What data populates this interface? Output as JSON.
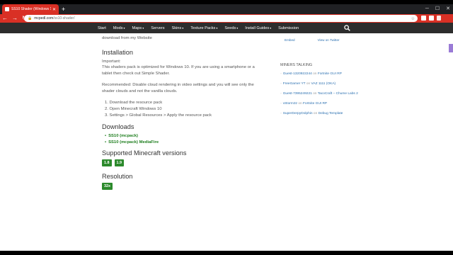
{
  "browser": {
    "tab_title": "SS10 Shader (Windows 10) | Mi...",
    "new_tab_label": "+",
    "address_domain": "mcpedl.com",
    "address_path": "/ss10-shader/"
  },
  "site_nav": {
    "items": [
      {
        "label": "Start",
        "caret": false
      },
      {
        "label": "Mods",
        "caret": true
      },
      {
        "label": "Maps",
        "caret": true
      },
      {
        "label": "Servers",
        "caret": false
      },
      {
        "label": "Skins",
        "caret": true
      },
      {
        "label": "Texture Packs",
        "caret": true
      },
      {
        "label": "Seeds",
        "caret": true
      },
      {
        "label": "Install Guides",
        "caret": true
      },
      {
        "label": "Submission",
        "caret": false
      }
    ]
  },
  "content": {
    "intro_tail": "download from my Website",
    "installation": {
      "heading": "Installation",
      "p1": "Important:",
      "p2": "This shaders pack is optimized for Windows 10. If you are using a smartphone or a tablet then check out Simple Shader.",
      "p3": "Recommended: Disable cloud rendering in video settings and you will see only the shader clouds and not the vanilla clouds.",
      "steps": [
        "1. Download the resource pack",
        "2. Open Minecraft Windows 10",
        "3. Settings > Global Resources > Apply the resource pack"
      ]
    },
    "downloads": {
      "heading": "Downloads",
      "items": [
        "SS10 (mcpack)",
        "SS10 (mcpack) MediaFire"
      ]
    },
    "versions": {
      "heading": "Supported Minecraft versions",
      "items": [
        "1.8",
        "1.9"
      ]
    },
    "resolution": {
      "heading": "Resolution",
      "items": [
        "32x"
      ]
    }
  },
  "sidebar": {
    "top_links": [
      "Embed",
      "View on Twitter"
    ],
    "title": "MINERS TALKING",
    "comments": [
      {
        "user": "Guest-1320922244",
        "on": "on",
        "post": "Fortnite GUI RP"
      },
      {
        "user": "FreeGamer YT",
        "on": "on",
        "post": "VAZ 1111 (OKA)"
      },
      {
        "user": "Guest-7395249221",
        "on": "on",
        "post": "TacoCraft – Chume Labs 2"
      },
      {
        "user": "vStorm3z",
        "on": "on",
        "post": "Fortnite GUI RP"
      },
      {
        "user": "SuperDerpyDolphin",
        "on": "on",
        "post": "Debug Template"
      }
    ]
  },
  "colors": {
    "chrome_red": "#d93025",
    "nav_bg": "#2d2d2d",
    "badge_green": "#2c8a2c",
    "link_green": "#1e7e1e"
  }
}
